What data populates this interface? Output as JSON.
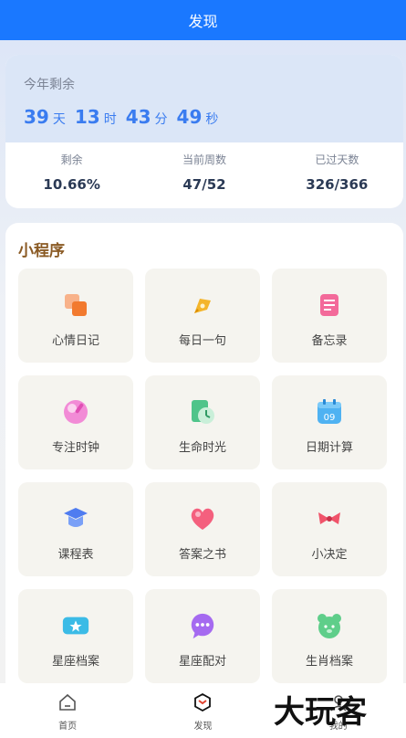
{
  "header": {
    "title": "发现"
  },
  "year_card": {
    "title": "今年剩余",
    "countdown": [
      {
        "value": "39",
        "unit": "天"
      },
      {
        "value": "13",
        "unit": "时"
      },
      {
        "value": "43",
        "unit": "分"
      },
      {
        "value": "49",
        "unit": "秒"
      }
    ],
    "stats": [
      {
        "label": "剩余",
        "value": "10.66%"
      },
      {
        "label": "当前周数",
        "value": "47/52"
      },
      {
        "label": "已过天数",
        "value": "326/366"
      }
    ]
  },
  "mini_programs": {
    "title": "小程序",
    "items": [
      {
        "label": "心情日记",
        "icon": "notes-icon"
      },
      {
        "label": "每日一句",
        "icon": "pen-icon"
      },
      {
        "label": "备忘录",
        "icon": "memo-icon"
      },
      {
        "label": "专注时钟",
        "icon": "focus-clock-icon"
      },
      {
        "label": "生命时光",
        "icon": "time-icon"
      },
      {
        "label": "日期计算",
        "icon": "calendar-icon"
      },
      {
        "label": "课程表",
        "icon": "graduation-cap-icon"
      },
      {
        "label": "答案之书",
        "icon": "heart-icon"
      },
      {
        "label": "小决定",
        "icon": "bow-icon"
      },
      {
        "label": "星座档案",
        "icon": "star-ticket-icon"
      },
      {
        "label": "星座配对",
        "icon": "chat-icon"
      },
      {
        "label": "生肖档案",
        "icon": "animal-face-icon"
      }
    ]
  },
  "tabbar": {
    "items": [
      {
        "label": "首页",
        "icon": "home-icon"
      },
      {
        "label": "发现",
        "icon": "discover-icon"
      },
      {
        "label": "我的",
        "icon": "profile-icon"
      }
    ]
  },
  "watermark": "大玩客"
}
